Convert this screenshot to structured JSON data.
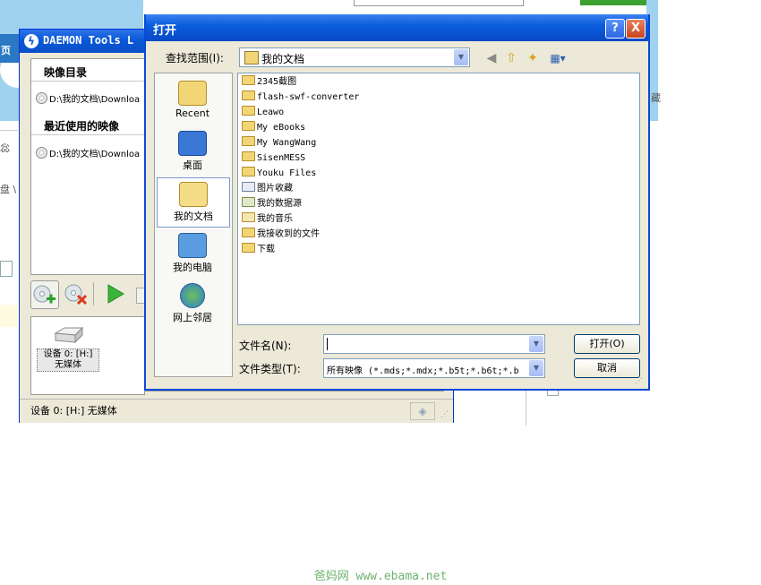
{
  "background": {
    "left_tab_text": "页",
    "left_text_1": "惢",
    "left_text_2": "盘 \\",
    "right_text": "藏"
  },
  "daemon": {
    "title": "DAEMON Tools L",
    "image_catalog_label": "映像目录",
    "catalog_item": "D:\\我的文档\\Downloa",
    "recent_label": "最近使用的映像",
    "recent_item": "D:\\我的文档\\Downloa",
    "device_label_line1": "设备 0: [H:]",
    "device_label_line2": "无媒体",
    "status_text": "设备 0: [H:] 无媒体"
  },
  "dialog": {
    "title": "打开",
    "help_label": "?",
    "close_label": "X",
    "look_in_label": "查找范围(I):",
    "look_in_value": "我的文档",
    "places": [
      {
        "label": "Recent"
      },
      {
        "label": "桌面"
      },
      {
        "label": "我的文档"
      },
      {
        "label": "我的电脑"
      },
      {
        "label": "网上邻居"
      }
    ],
    "files": [
      {
        "name": "2345截图"
      },
      {
        "name": "flash-swf-converter"
      },
      {
        "name": "Leawo"
      },
      {
        "name": "My eBooks"
      },
      {
        "name": "My WangWang"
      },
      {
        "name": "SisenMESS"
      },
      {
        "name": "Youku Files"
      },
      {
        "name": "图片收藏"
      },
      {
        "name": "我的数据源"
      },
      {
        "name": "我的音乐"
      },
      {
        "name": "我接收到的文件"
      },
      {
        "name": "下载"
      }
    ],
    "filename_label": "文件名(N):",
    "filename_value": "",
    "filetype_label": "文件类型(T):",
    "filetype_value": "所有映像 (*.mds;*.mdx;*.b5t;*.b6t;*.b",
    "open_button": "打开(O)",
    "cancel_button": "取消"
  },
  "watermark": "爸妈网 www.ebama.net"
}
